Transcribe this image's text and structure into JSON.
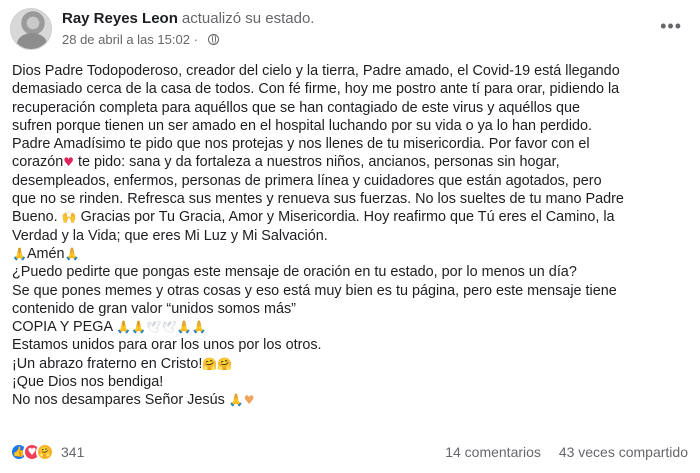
{
  "post": {
    "author": "Ray Reyes Leon",
    "action": "actualizó su estado.",
    "timestamp": "28 de abril a las 15:02",
    "separator": "·",
    "more_label": "•••",
    "icons": {
      "privacy": "globe-icon",
      "menu": "more-options-icon"
    }
  },
  "body": {
    "l1": "Dios Padre Todopoderoso, creador del cielo y la tierra, Padre amado, el Covid-19 está llegando",
    "l2": "demasiado cerca de la casa de todos. Con fé firme, hoy me postro ante tí para orar, pidiendo la",
    "l3": "recuperación completa para aquéllos que se han contagiado de este virus y aquéllos que",
    "l4": "sufren porque tienen un ser amado en el hospital luchando por su vida o ya lo han perdido.",
    "l5": "Padre Amadísimo te pido que nos protejas y nos llenes de tu misericordia. Por favor con el",
    "l6_a": "corazón",
    "l6_b": " te pido: sana y da fortaleza a nuestros niños, ancianos, personas sin hogar,",
    "l7": "desempleados, enfermos, personas de primera línea y cuidadores que están agotados, pero",
    "l8": "que no se rinden. Refresca sus mentes y renueva sus fuerzas. No los sueltes de tu mano Padre",
    "l9_a": "Bueno.",
    "l9_b": " Gracias por Tu Gracia, Amor y Misericordia. Hoy reafirmo que Tú eres el Camino, la",
    "l10": "Verdad y la Vida; que eres Mi Luz y Mi Salvación.",
    "l11": "Amén",
    "l12": "¿Puedo pedirte que pongas este mensaje de oración en tu estado, por lo menos un día?",
    "l13": "Se que pones memes y otras cosas y eso está muy bien es tu página, pero este mensaje tiene",
    "l14": "contenido de gran valor “unidos somos más”",
    "l15": "COPIA Y PEGA",
    "l16": "Estamos unidos para orar los unos por los otros.",
    "l17": "¡Un abrazo fraterno en Cristo!",
    "l18": "¡Que Dios nos bendiga!",
    "l19": "No nos desampares Señor Jesús",
    "emoji": {
      "heart": "♥",
      "praise": "🙌",
      "pray": "🙏",
      "dove": "🕊",
      "hug": "🤗",
      "pray_heart": "🙏♥"
    }
  },
  "footer": {
    "reaction_icons": [
      "like-icon",
      "love-icon",
      "care-icon"
    ],
    "reaction_glyphs": {
      "like": "👍",
      "love": "♥",
      "care": "🤗"
    },
    "reaction_count": "341",
    "comments": "14 comentarios",
    "shares": "43 veces compartido"
  },
  "colors": {
    "text": "#1c1e21",
    "secondary": "#65676b",
    "like": "#1877f2",
    "love": "#f33e58",
    "care": "#f7b125"
  }
}
